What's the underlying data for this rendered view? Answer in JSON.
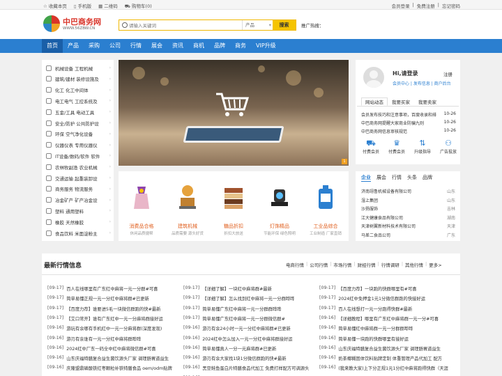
{
  "topbar": {
    "left": [
      {
        "icon": "star-icon",
        "label": "收藏本页"
      },
      {
        "icon": "phone-icon",
        "label": "手机版"
      },
      {
        "icon": "qrcode-icon",
        "label": "二维码"
      },
      {
        "icon": "cart-icon",
        "label": "购物车(0)"
      }
    ],
    "right": [
      "会员登录",
      "|",
      "免费注册",
      "|",
      "忘记密码"
    ]
  },
  "logo": {
    "name": "中巴商务网",
    "url": "WWW.56ZBW.CN"
  },
  "search": {
    "placeholder": "请输入关键词",
    "category": "产品",
    "button": "搜索"
  },
  "hot": {
    "label": "推广热搜："
  },
  "nav": [
    "首页",
    "产品",
    "采购",
    "公司",
    "行情",
    "展会",
    "资讯",
    "商机",
    "品牌",
    "商务",
    "VIP升级"
  ],
  "menu": [
    "机械设备 工程机械",
    "建筑/建材 装修设施及",
    "化工 化工中间体",
    "电工电气 工控系统及",
    "五金/工具 电动工具",
    "安全/防护 公共防护设",
    "环保 空气净化设备",
    "仪器仪表 专用仪器仪",
    "IT设备/数码/软件 软件",
    "农林牧副渔 农业机械",
    "交通运输 起重装卸设",
    "商务服务 物流服务",
    "冶金矿产 矿产冶金设",
    "塑料 通用塑料",
    "橡胶 天然橡胶",
    "食品饮料 米面淀粉主"
  ],
  "features": [
    {
      "title": "消费品合格",
      "sub": "休闲品质捷帮"
    },
    {
      "title": "建筑机械",
      "sub": "品质需要 源头好货"
    },
    {
      "title": "糖品折扣",
      "sub": "折扣大放送"
    },
    {
      "title": "灯饰精品",
      "sub": "节能环保 绿色照明"
    },
    {
      "title": "工业品综合",
      "sub": "工业制造 厂家直销"
    }
  ],
  "login": {
    "title": "Hi,请登录",
    "register": "注册",
    "links": "会员中心 | 发布信息 | 商户后台"
  },
  "tabs": [
    "网站动态",
    "我要买家",
    "我要卖家"
  ],
  "news": [
    {
      "t": "会员发布技巧和注意事项，百度收录和排",
      "d": "10-26"
    },
    {
      "t": "中巴商务网提醒大家商业防骗九则",
      "d": "10-26"
    },
    {
      "t": "中巴商务网信息审核规范",
      "d": "10-26"
    }
  ],
  "quick": [
    {
      "icon": "truck-icon",
      "g": "⛟",
      "label": "付费会员"
    },
    {
      "icon": "member-icon",
      "g": "♛",
      "label": "付费会员"
    },
    {
      "icon": "upgrade-icon",
      "g": "⇅",
      "label": "升级指导"
    },
    {
      "icon": "promo-icon",
      "g": "⚇",
      "label": "广告投放"
    }
  ],
  "cotabs": [
    "企业",
    "展会",
    "行情",
    "头条",
    "品牌"
  ],
  "companies": [
    {
      "n": "济南翊鲁机械设备有限公司",
      "p": "山东"
    },
    {
      "n": "湿上集团",
      "p": "山东"
    },
    {
      "n": "沙扬服饰",
      "p": "吉林"
    },
    {
      "n": "江大健康食品有限公司",
      "p": "湖南"
    },
    {
      "n": "天津树翼新材料技术有限公司",
      "p": "天津"
    },
    {
      "n": "马差二食品公司",
      "p": "广东"
    }
  ],
  "latest": {
    "title": "最新行情信息",
    "cats": [
      "电商行情",
      "公司行情",
      "市场行情",
      "财经行情",
      "行情调研",
      "其他行情",
      "更多>"
    ],
    "cols": [
      [
        {
          "d": "[09-17]",
          "t": "百人在线哪里有广东红中麻将一元一分群#可喜"
        },
        {
          "d": "[09-17]",
          "t": "简单易懂正规一元一分红中麻将群#已更新"
        },
        {
          "d": "[09-17]",
          "t": "【百度力荐】谁要进5毛一块微信群跑的快#最新"
        },
        {
          "d": "[09-17]",
          "t": "【艾口常开】谁有广东红中一元一分麻将群接好运"
        },
        {
          "d": "[09-16]",
          "t": "游玩有余哪有手机红中一元一分麻将群(深度发现)"
        },
        {
          "d": "[09-16]",
          "t": "游刃有余谁有一元一分红中麻将群哗哗"
        },
        {
          "d": "[09-16]",
          "t": "2024红中厂东一码全中红中麻将微信群#可喜"
        },
        {
          "d": "[09-16]",
          "t": "山东庆福特膳复合益生菌饮源头厂家 调理肠胃道益生"
        },
        {
          "d": "[09-16]",
          "t": "庆隆盟鼎磷酸铁红枣颗粒补铁特膳食品 oem/odm贴牌"
        }
      ],
      [
        {
          "d": "[09-17]",
          "t": "【详细了解】一块红中麻将群#最新"
        },
        {
          "d": "[09-17]",
          "t": "【详细了解】怎么找到红中麻将一元一分群哗哗"
        },
        {
          "d": "[09-17]",
          "t": "简单易懂广东红中麻将一元一分群群哗哗"
        },
        {
          "d": "[09-17]",
          "t": "简单易懂广东红中麻将一元一分群微信群#"
        },
        {
          "d": "[09-16]",
          "t": "游刃有余24小时一元一分红中麻将群#已更新"
        },
        {
          "d": "[09-16]",
          "t": "2024红中怎么加入一元一分红中麻将群接好运"
        },
        {
          "d": "[09-16]",
          "t": "简单易懂真人一分一元麻将群#已更新"
        },
        {
          "d": "[09-16]",
          "t": "游刃有余大家找1块1分微信群跑的快#最新"
        },
        {
          "d": "[09-16]",
          "t": "黑豆鲑鱼蛋白片特膳食品代加工 免费打样配方可调源头"
        },
        {
          "d": "[09-16]",
          "t": "(我来教大家)手机24小时一元一分红中麻将群（天涯）"
        }
      ],
      [
        {
          "d": "[09-17]",
          "t": "【百度力荐】一块跑的快群哪里有#可喜"
        },
        {
          "d": "[09-17]",
          "t": "2024红中免押金1元1分微信群跑的快接好运"
        },
        {
          "d": "[09-17]",
          "t": "百人在线想打一元一分跑得快群#最新"
        },
        {
          "d": "[09-16]",
          "t": "【详细教程】哪里有广东红中麻将群一元一分#可喜"
        },
        {
          "d": "[09-16]",
          "t": "简单易懂红中麻将群一元一分群群哗哗"
        },
        {
          "d": "[09-16]",
          "t": "简单易懂一块跑的快群哪里有接好运"
        },
        {
          "d": "[09-16]",
          "t": "山东庆福特膳复合益生菌饮源头厂家 调理肠胃道益生"
        },
        {
          "d": "[09-16]",
          "t": "奶茶椰糊固体饮料贴牌定制 体重管理产品代加工 配方"
        },
        {
          "d": "[09-16]",
          "t": "(我来教大家)上下分正规1元1分红中麻将跑得快群（天涯"
        }
      ]
    ]
  },
  "colors": {
    "nav": "#2b7fd0",
    "navActive": "#1a5fa8",
    "searchBtn": "#f5c400",
    "accent": "#e06020"
  }
}
